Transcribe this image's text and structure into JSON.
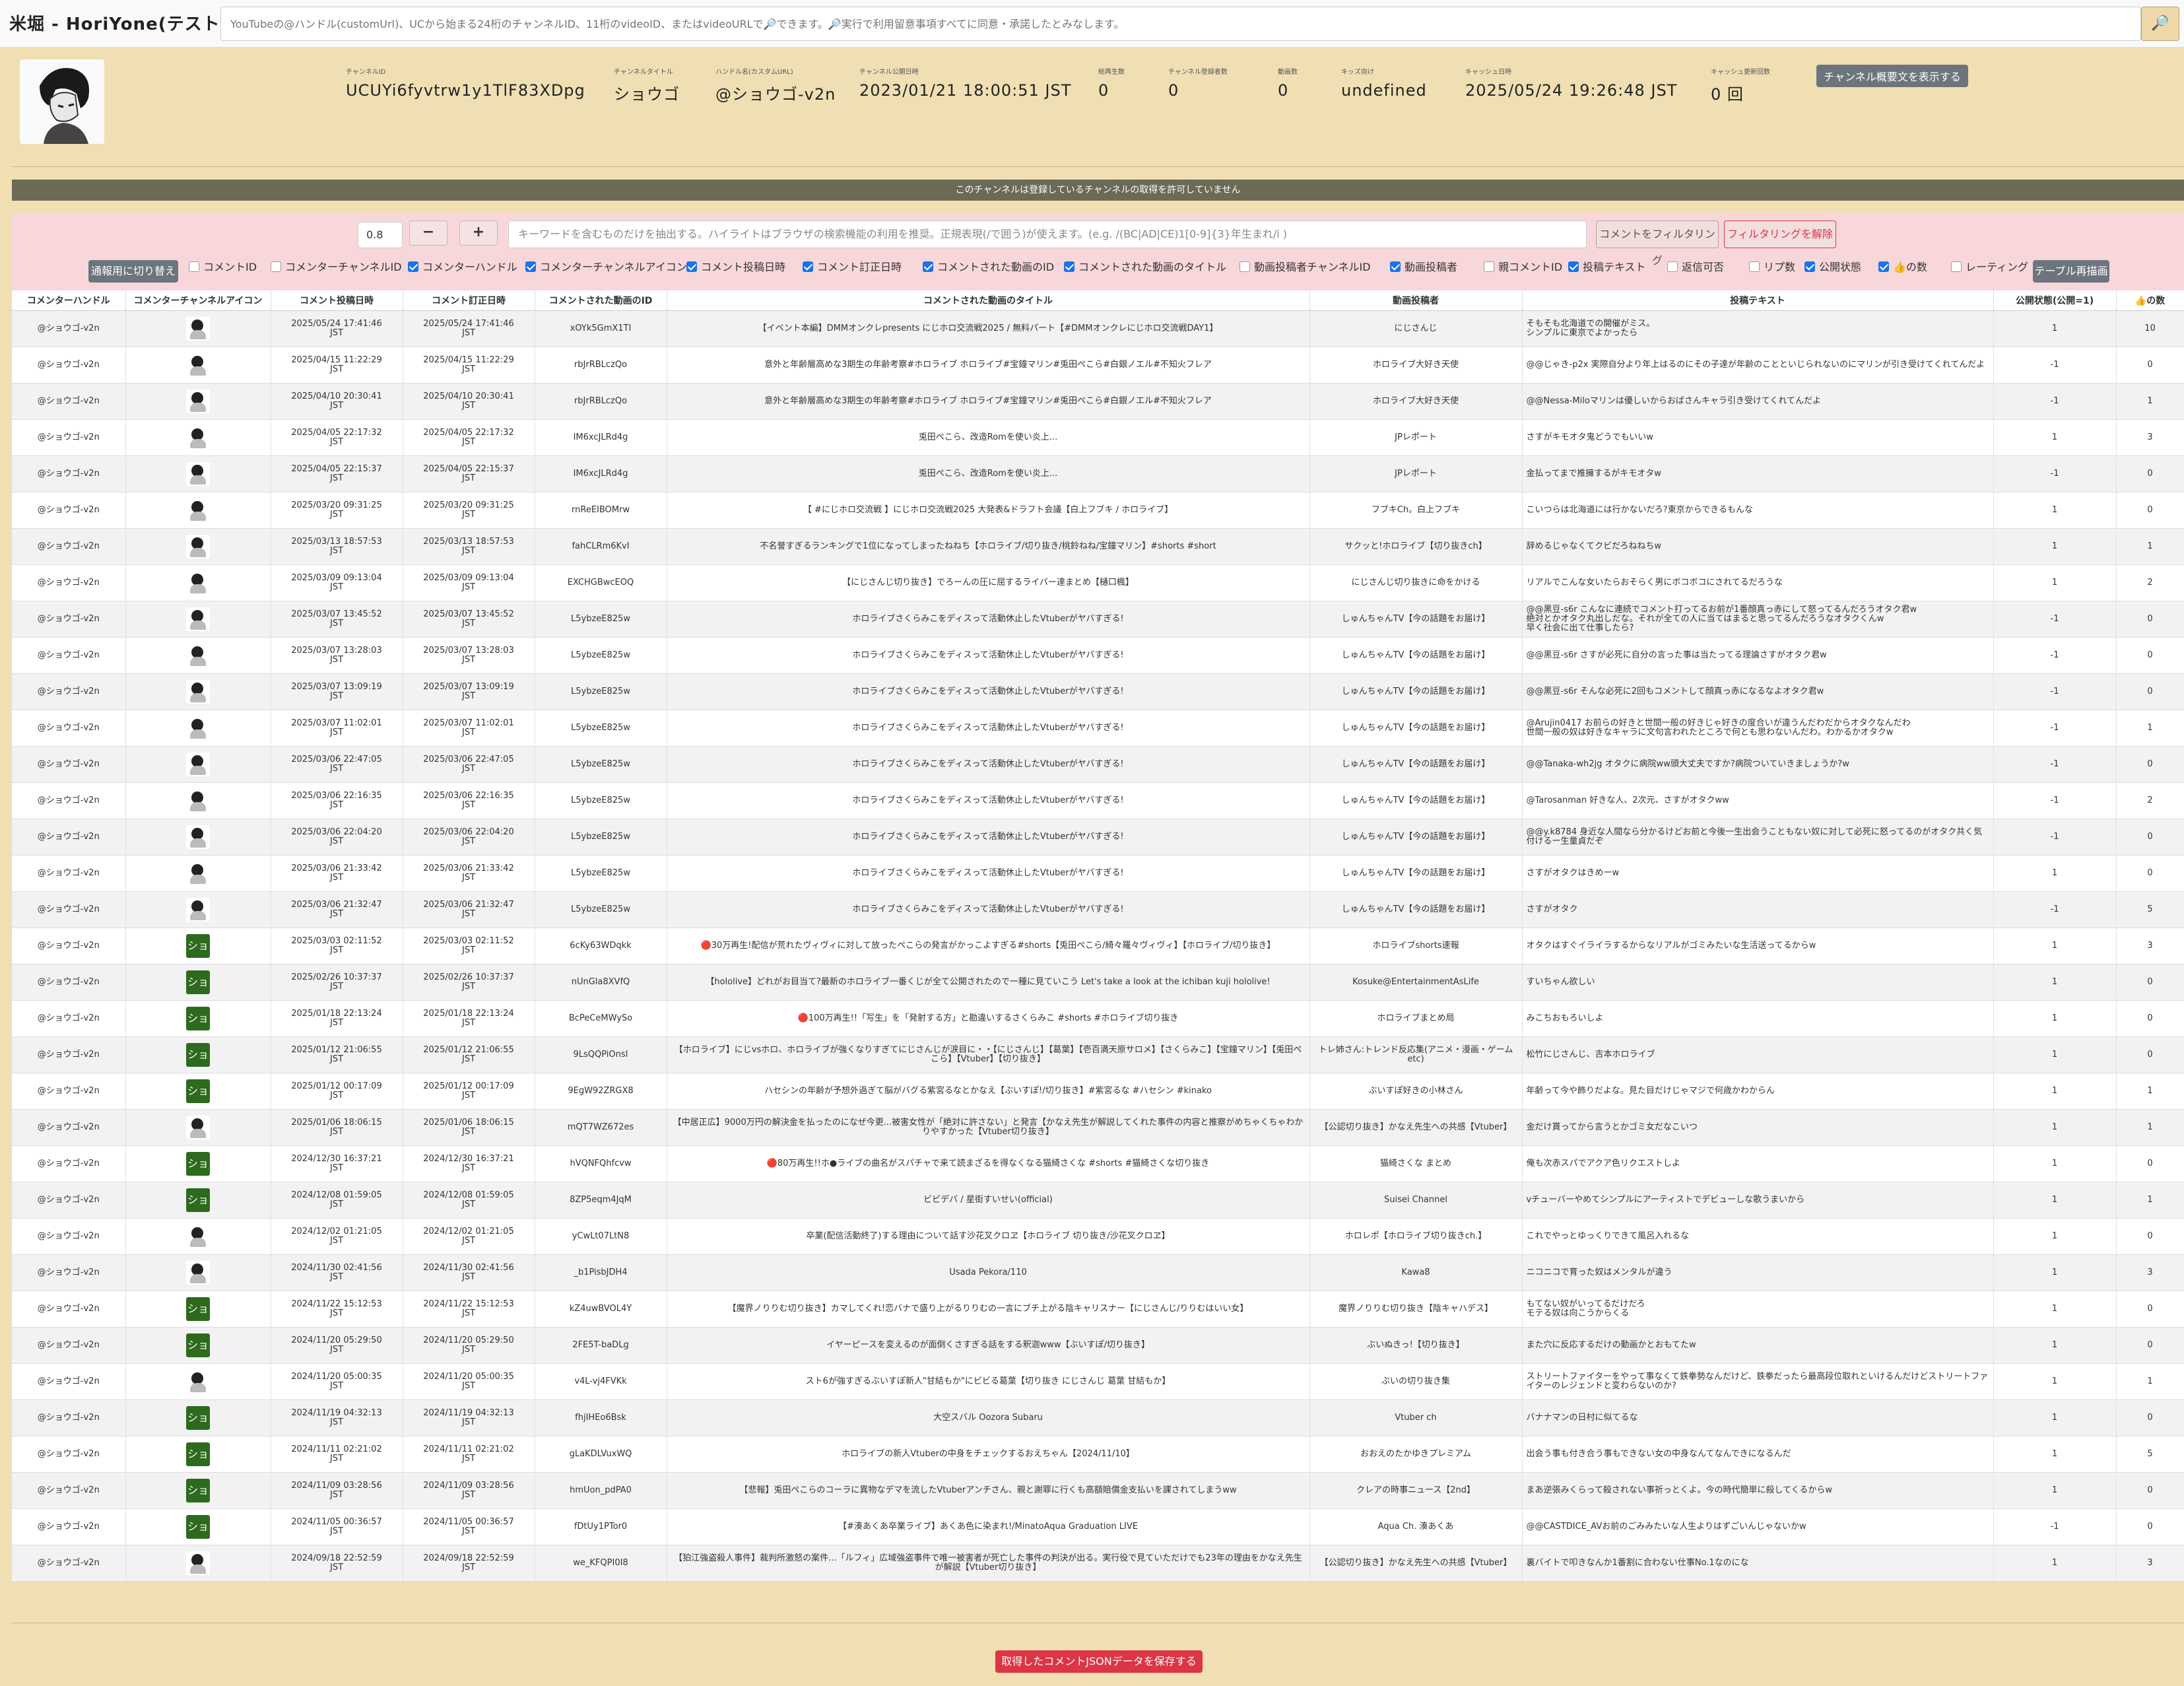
{
  "app": {
    "title": "米堀 - HoriYone(テスト中)",
    "search_placeholder": "YouTubeの@ハンドル(customUrl)、UCから始まる24桁のチャンネルID、11桁のvideoID、またはvideoURLで🔎できます。🔎実行で利用留意事項すべてに同意・承諾したとみなします。",
    "search_icon": "🔎"
  },
  "channel": {
    "fields": [
      {
        "label": "チャンネルID",
        "value": "UCUYi6fyvtrw1y1TlF83XDpg"
      },
      {
        "label": "チャンネルタイトル",
        "value": "ショウゴ"
      },
      {
        "label": "ハンドル名(カスタムURL)",
        "value": "@ショウゴ-v2n"
      },
      {
        "label": "チャンネル公開日時",
        "value": "2023/01/21 18:00:51 JST"
      },
      {
        "label": "総再生数",
        "value": "0"
      },
      {
        "label": "チャンネル登録者数",
        "value": "0"
      },
      {
        "label": "動画数",
        "value": "0"
      },
      {
        "label": "キッズ向け",
        "value": "undefined"
      },
      {
        "label": "キャッシュ日時",
        "value": "2025/05/24 19:26:48 JST"
      },
      {
        "label": "キャッシュ更新回数",
        "value": "0 回"
      }
    ],
    "show_desc_button": "チャンネル概要文を表示する"
  },
  "notice": "このチャンネルは登録しているチャンネルの取得を許可していません",
  "filter": {
    "threshold": "0.8",
    "minus": "−",
    "plus": "+",
    "keyword_placeholder": "キーワードを含むものだけを抽出する。ハイライトはブラウザの検索機能の利用を推奨。正規表現(/で囲う)が使えます。(e.g. /(BC|AD|CE)1[0-9]{3}年生まれ/i )",
    "filter_button": "コメントをフィルタリング",
    "unfilter_button": "フィルタリングを解除"
  },
  "mode_button": "通報用に切り替え",
  "toggles": [
    {
      "label": "コメントID",
      "checked": false
    },
    {
      "label": "コメンターチャンネルID",
      "checked": false
    },
    {
      "label": "コメンターハンドル",
      "checked": true
    },
    {
      "label": "コメンターチャンネルアイコン",
      "checked": true
    },
    {
      "label": "コメント投稿日時",
      "checked": true
    },
    {
      "label": "コメント訂正日時",
      "checked": true
    },
    {
      "label": "コメントされた動画のID",
      "checked": true
    },
    {
      "label": "コメントされた動画のタイトル",
      "checked": true
    },
    {
      "label": "動画投稿者チャンネルID",
      "checked": false
    },
    {
      "label": "動画投稿者",
      "checked": true
    },
    {
      "label": "親コメントID",
      "checked": false
    },
    {
      "label": "投稿テキスト",
      "checked": true
    },
    {
      "label": "返信可否",
      "checked": false
    },
    {
      "label": "リプ数",
      "checked": false
    },
    {
      "label": "公開状態",
      "checked": true
    },
    {
      "label": "👍の数",
      "checked": true
    },
    {
      "label": "レーティング",
      "checked": false
    }
  ],
  "redraw_button": "テーブル再描画",
  "table": {
    "headers": [
      "コメンターハンドル",
      "コメンターチャンネルアイコン",
      "コメント投稿日時",
      "コメント訂正日時",
      "コメントされた動画のID",
      "コメントされた動画のタイトル",
      "動画投稿者",
      "投稿テキスト",
      "公開状態(公開=1)",
      "👍の数"
    ],
    "rows": [
      {
        "handle": "@ショウゴ-v2n",
        "icon": "photo",
        "posted": "2025/05/24 17:41:46",
        "edited": "2025/05/24 17:41:46",
        "tz": "JST",
        "vid": "xOYk5GmX1TI",
        "vtitle": "【イベント本編】DMMオンクレpresents にじホロ交流戦2025 / 無料パート【#DMMオンクレにじホロ交流戦DAY1】",
        "author": "にじさんじ",
        "text": "そもそも北海道での開催がミス。\nシンプルに東京でよかったら",
        "status": "1",
        "likes": "10"
      },
      {
        "handle": "@ショウゴ-v2n",
        "icon": "photo",
        "posted": "2025/04/15 11:22:29",
        "edited": "2025/04/15 11:22:29",
        "tz": "JST",
        "vid": "rbJrRBLczQo",
        "vtitle": "意外と年齢層高めな3期生の年齢考察#ホロライブ ホロライブ#宝鐘マリン#兎田ぺこら#白銀ノエル#不知火フレア",
        "author": "ホロライブ大好き天使",
        "text": "@@じゃき-p2x 実際自分より年上はるのにその子達が年齢のことといじられないのにマリンが引き受けてくれてんだよ",
        "status": "-1",
        "likes": "0"
      },
      {
        "handle": "@ショウゴ-v2n",
        "icon": "photo",
        "posted": "2025/04/10 20:30:41",
        "edited": "2025/04/10 20:30:41",
        "tz": "JST",
        "vid": "rbJrRBLczQo",
        "vtitle": "意外と年齢層高めな3期生の年齢考察#ホロライブ ホロライブ#宝鐘マリン#兎田ぺこら#白銀ノエル#不知火フレア",
        "author": "ホロライブ大好き天使",
        "text": "@@Nessa-Miloマリンは優しいからおばさんキャラ引き受けてくれてんだよ",
        "status": "-1",
        "likes": "1"
      },
      {
        "handle": "@ショウゴ-v2n",
        "icon": "photo",
        "posted": "2025/04/05 22:17:32",
        "edited": "2025/04/05 22:17:32",
        "tz": "JST",
        "vid": "IM6xcJLRd4g",
        "vtitle": "兎田ぺこら、改造Romを使い炎上...",
        "author": "JPレポート",
        "text": "さすがキモオタ鬼どうでもいいw",
        "status": "1",
        "likes": "3"
      },
      {
        "handle": "@ショウゴ-v2n",
        "icon": "photo",
        "posted": "2025/04/05 22:15:37",
        "edited": "2025/04/05 22:15:37",
        "tz": "JST",
        "vid": "IM6xcJLRd4g",
        "vtitle": "兎田ぺこら、改造Romを使い炎上...",
        "author": "JPレポート",
        "text": "金払ってまで推擁するがキモオタw",
        "status": "-1",
        "likes": "0"
      },
      {
        "handle": "@ショウゴ-v2n",
        "icon": "photo",
        "posted": "2025/03/20 09:31:25",
        "edited": "2025/03/20 09:31:25",
        "tz": "JST",
        "vid": "rnReEIBOMrw",
        "vtitle": "【 #にじホロ交流戦 】にじホロ交流戦2025 大発表&ドラフト会議【白上フブキ / ホロライブ】",
        "author": "フブキCh。白上フブキ",
        "text": "こいつらは北海道には行かないだろ?東京からできるもんな",
        "status": "1",
        "likes": "0"
      },
      {
        "handle": "@ショウゴ-v2n",
        "icon": "photo",
        "posted": "2025/03/13 18:57:53",
        "edited": "2025/03/13 18:57:53",
        "tz": "JST",
        "vid": "fahCLRm6KvI",
        "vtitle": "不名誉すぎるランキングで1位になってしまったねねち【ホロライブ/切り抜き/桃鈴ねね/宝鐘マリン】#shorts #short",
        "author": "サクッと!ホロライブ【切り抜きch】",
        "text": "辞めるじゃなくてクビだろねねちw",
        "status": "1",
        "likes": "1"
      },
      {
        "handle": "@ショウゴ-v2n",
        "icon": "photo",
        "posted": "2025/03/09 09:13:04",
        "edited": "2025/03/09 09:13:04",
        "tz": "JST",
        "vid": "EXCHGBwcEOQ",
        "vtitle": "【にじさんじ切り抜き】でろーんの圧に屈するライバー達まとめ【樋口楓】",
        "author": "にじさんじ切り抜きに命をかける",
        "text": "リアルでこんな女いたらおそらく男にボコボコにされてるだろうな",
        "status": "1",
        "likes": "2"
      },
      {
        "handle": "@ショウゴ-v2n",
        "icon": "photo",
        "posted": "2025/03/07 13:45:52",
        "edited": "2025/03/07 13:45:52",
        "tz": "JST",
        "vid": "L5ybzeE825w",
        "vtitle": "ホロライブさくらみこをディスって活動休止したVtuberがヤバすぎる!",
        "author": "しゅんちゃんTV【今の話題をお届け】",
        "text": "@@黒豆-s6r こんなに連続でコメント打ってるお前が1番顔真っ赤にして怒ってるんだろうオタク君w\n絶対とかオタク丸出しだな。それが全ての人に当てはまると思ってるんだろうなオタクくんw\n早く社会に出て仕事したら?",
        "status": "-1",
        "likes": "0"
      },
      {
        "handle": "@ショウゴ-v2n",
        "icon": "photo",
        "posted": "2025/03/07 13:28:03",
        "edited": "2025/03/07 13:28:03",
        "tz": "JST",
        "vid": "L5ybzeE825w",
        "vtitle": "ホロライブさくらみこをディスって活動休止したVtuberがヤバすぎる!",
        "author": "しゅんちゃんTV【今の話題をお届け】",
        "text": "@@黒豆-s6r さすが必死に自分の言った事は当たってる理論さすがオタク君w",
        "status": "-1",
        "likes": "0"
      },
      {
        "handle": "@ショウゴ-v2n",
        "icon": "photo",
        "posted": "2025/03/07 13:09:19",
        "edited": "2025/03/07 13:09:19",
        "tz": "JST",
        "vid": "L5ybzeE825w",
        "vtitle": "ホロライブさくらみこをディスって活動休止したVtuberがヤバすぎる!",
        "author": "しゅんちゃんTV【今の話題をお届け】",
        "text": "@@黒豆-s6r そんな必死に2回もコメントして顔真っ赤になるなよオタク君w",
        "status": "-1",
        "likes": "0"
      },
      {
        "handle": "@ショウゴ-v2n",
        "icon": "photo",
        "posted": "2025/03/07 11:02:01",
        "edited": "2025/03/07 11:02:01",
        "tz": "JST",
        "vid": "L5ybzeE825w",
        "vtitle": "ホロライブさくらみこをディスって活動休止したVtuberがヤバすぎる!",
        "author": "しゅんちゃんTV【今の話題をお届け】",
        "text": "@Arujin0417 お前らの好きと世間一般の好きじゃ好きの度合いが違うんだわだからオタクなんだわ\n世間一般の奴は好きなキャラに文句言われたところで何とも思わないんだわ。わかるかオタクw",
        "status": "-1",
        "likes": "1"
      },
      {
        "handle": "@ショウゴ-v2n",
        "icon": "photo",
        "posted": "2025/03/06 22:47:05",
        "edited": "2025/03/06 22:47:05",
        "tz": "JST",
        "vid": "L5ybzeE825w",
        "vtitle": "ホロライブさくらみこをディスって活動休止したVtuberがヤバすぎる!",
        "author": "しゅんちゃんTV【今の話題をお届け】",
        "text": "@@Tanaka-wh2jg オタクに病院ww頭大丈夫ですか?病院ついていきましょうか?w",
        "status": "-1",
        "likes": "0"
      },
      {
        "handle": "@ショウゴ-v2n",
        "icon": "photo",
        "posted": "2025/03/06 22:16:35",
        "edited": "2025/03/06 22:16:35",
        "tz": "JST",
        "vid": "L5ybzeE825w",
        "vtitle": "ホロライブさくらみこをディスって活動休止したVtuberがヤバすぎる!",
        "author": "しゅんちゃんTV【今の話題をお届け】",
        "text": "@Tarosanman 好きな人、2次元、さすがオタクww",
        "status": "-1",
        "likes": "2"
      },
      {
        "handle": "@ショウゴ-v2n",
        "icon": "photo",
        "posted": "2025/03/06 22:04:20",
        "edited": "2025/03/06 22:04:20",
        "tz": "JST",
        "vid": "L5ybzeE825w",
        "vtitle": "ホロライブさくらみこをディスって活動休止したVtuberがヤバすぎる!",
        "author": "しゅんちゃんTV【今の話題をお届け】",
        "text": "@@y.k8784 身近な人間なら分かるけどお前と今後一生出会うこともない奴に対して必死に怒ってるのがオタク共く気付けるー生童貞だぞ",
        "status": "-1",
        "likes": "0"
      },
      {
        "handle": "@ショウゴ-v2n",
        "icon": "photo",
        "posted": "2025/03/06 21:33:42",
        "edited": "2025/03/06 21:33:42",
        "tz": "JST",
        "vid": "L5ybzeE825w",
        "vtitle": "ホロライブさくらみこをディスって活動休止したVtuberがヤバすぎる!",
        "author": "しゅんちゃんTV【今の話題をお届け】",
        "text": "さすがオタクはきめーw",
        "status": "1",
        "likes": "0"
      },
      {
        "handle": "@ショウゴ-v2n",
        "icon": "photo",
        "posted": "2025/03/06 21:32:47",
        "edited": "2025/03/06 21:32:47",
        "tz": "JST",
        "vid": "L5ybzeE825w",
        "vtitle": "ホロライブさくらみこをディスって活動休止したVtuberがヤバすぎる!",
        "author": "しゅんちゃんTV【今の話題をお届け】",
        "text": "さすがオタク",
        "status": "-1",
        "likes": "5"
      },
      {
        "handle": "@ショウゴ-v2n",
        "icon": "sho",
        "posted": "2025/03/03 02:11:52",
        "edited": "2025/03/03 02:11:52",
        "tz": "JST",
        "vid": "6cKy63WDqkk",
        "vtitle": "🔴30万再生!配信が荒れたヴィヴィに対して放ったぺこらの発言がかっこよすぎる#shorts【兎田ぺこら/綺々羅々ヴィヴィ】【ホロライブ/切り抜き】",
        "author": "ホロライブshorts速報",
        "text": "オタクはすぐイライラするからなリアルがゴミみたいな生活送ってるからw",
        "status": "1",
        "likes": "3"
      },
      {
        "handle": "@ショウゴ-v2n",
        "icon": "sho",
        "posted": "2025/02/26 10:37:37",
        "edited": "2025/02/26 10:37:37",
        "tz": "JST",
        "vid": "nUnGla8XVfQ",
        "vtitle": "【hololive】どれがお目当て?最新のホロライブ一番くじが全て公開されたので一種に見ていこう Let's take a look at the ichiban kuji hololive!",
        "author": "Kosuke@EntertainmentAsLife",
        "text": "すいちゃん欲しい",
        "status": "1",
        "likes": "0"
      },
      {
        "handle": "@ショウゴ-v2n",
        "icon": "sho",
        "posted": "2025/01/18 22:13:24",
        "edited": "2025/01/18 22:13:24",
        "tz": "JST",
        "vid": "BcPeCeMWySo",
        "vtitle": "🔴100万再生!!「写生」を「発射する方」と勘違いするさくらみこ #shorts #ホロライブ切り抜き",
        "author": "ホロライブまとめ局",
        "text": "みこちおもろいしよ",
        "status": "1",
        "likes": "0"
      },
      {
        "handle": "@ショウゴ-v2n",
        "icon": "sho",
        "posted": "2025/01/12 21:06:55",
        "edited": "2025/01/12 21:06:55",
        "tz": "JST",
        "vid": "9LsQQPiOnsI",
        "vtitle": "【ホロライブ】にじvsホロ、ホロライブが強くなりすぎてにじさんじが涙目に・・【にじさんじ】【葛葉】【壱百満天原サロメ】【さくらみこ】【宝鐘マリン】【兎田ぺこら】【Vtuber】【切り抜き】",
        "author": "トレ姉さん:トレンド反応集(アニメ・漫画・ゲーム etc)",
        "text": "松竹にじさんじ、吉本ホロライブ",
        "status": "1",
        "likes": "0"
      },
      {
        "handle": "@ショウゴ-v2n",
        "icon": "sho",
        "posted": "2025/01/12 00:17:09",
        "edited": "2025/01/12 00:17:09",
        "tz": "JST",
        "vid": "9EgW92ZRGX8",
        "vtitle": "ハセシンの年齢が予想外過ぎて脳がバグる紫宮るなとかなえ【ぶいすぽ!/切り抜き】#紫宮るな #ハセシン #kinako",
        "author": "ぶいすぽ好きの小林さん",
        "text": "年齢って今や飾りだよな。見た目だけじゃマジで何歳かわからん",
        "status": "1",
        "likes": "1"
      },
      {
        "handle": "@ショウゴ-v2n",
        "icon": "photo",
        "posted": "2025/01/06 18:06:15",
        "edited": "2025/01/06 18:06:15",
        "tz": "JST",
        "vid": "mQT7WZ672es",
        "vtitle": "【中居正広】9000万円の解決金を払ったのになぜ今更...被害女性が「絶対に許さない」と発言【かなえ先生が解説してくれた事件の内容と推察がめちゃくちゃわかりやすかった【Vtuber切り抜き】",
        "author": "【公認切り抜き】かなえ先生への共感【Vtuber】",
        "text": "金だけ貰ってから言うとかゴミ女だなこいつ",
        "status": "1",
        "likes": "1"
      },
      {
        "handle": "@ショウゴ-v2n",
        "icon": "sho",
        "posted": "2024/12/30 16:37:21",
        "edited": "2024/12/30 16:37:21",
        "tz": "JST",
        "vid": "hVQNFQhfcvw",
        "vtitle": "🔴80万再生!!ホ●ライブの曲名がスパチャで来て読まざるを得なくなる猫綺さくな #shorts #猫綺さくな切り抜き",
        "author": "猫綺さくな まとめ",
        "text": "俺も次赤スパでアクア色リクエストしよ",
        "status": "1",
        "likes": "0"
      },
      {
        "handle": "@ショウゴ-v2n",
        "icon": "sho",
        "posted": "2024/12/08 01:59:05",
        "edited": "2024/12/08 01:59:05",
        "tz": "JST",
        "vid": "8ZP5eqm4JqM",
        "vtitle": "ビビデバ / 星街すいせい(official)",
        "author": "Suisei Channel",
        "text": "vチューバーやめてシンプルにアーティストでデビューしな歌うまいから",
        "status": "1",
        "likes": "1"
      },
      {
        "handle": "@ショウゴ-v2n",
        "icon": "photo",
        "posted": "2024/12/02 01:21:05",
        "edited": "2024/12/02 01:21:05",
        "tz": "JST",
        "vid": "yCwLt07LtN8",
        "vtitle": "卒業(配信活動終了)する理由について話す沙花叉クロヱ【ホロライブ 切り抜き/沙花叉クロヱ】",
        "author": "ホロレポ【ホロライブ切り抜きch.】",
        "text": "これでやっとゆっくりできて風呂入れるな",
        "status": "1",
        "likes": "0"
      },
      {
        "handle": "@ショウゴ-v2n",
        "icon": "photo",
        "posted": "2024/11/30 02:41:56",
        "edited": "2024/11/30 02:41:56",
        "tz": "JST",
        "vid": "_b1PisbJDH4",
        "vtitle": "Usada Pekora/110",
        "author": "Kawa8",
        "text": "ニコニコで育った奴はメンタルが違う",
        "status": "1",
        "likes": "3"
      },
      {
        "handle": "@ショウゴ-v2n",
        "icon": "sho",
        "posted": "2024/11/22 15:12:53",
        "edited": "2024/11/22 15:12:53",
        "tz": "JST",
        "vid": "kZ4uwBVOL4Y",
        "vtitle": "【魔界ノりりむ切り抜き】カマしてくれ!恋バナで盛り上がるりりむの一言にブチ上がる陰キャリスナー【にじさんじ/りりむはいい女】",
        "author": "魔界ノりりむ切り抜き【陰キャハデス】",
        "text": "もてない奴がいってるだけだろ\nモテる奴は向こうからくる",
        "status": "1",
        "likes": "0"
      },
      {
        "handle": "@ショウゴ-v2n",
        "icon": "sho",
        "posted": "2024/11/20 05:29:50",
        "edited": "2024/11/20 05:29:50",
        "tz": "JST",
        "vid": "2FE5T-baDLg",
        "vtitle": "イヤーピースを変えるのが面倒くさすぎる話をする釈迦www【ぶいすぽ/切り抜き】",
        "author": "ぶいぬきっ!【切り抜き】",
        "text": "また穴に反応するだけの動画かとおもてたw",
        "status": "1",
        "likes": "0"
      },
      {
        "handle": "@ショウゴ-v2n",
        "icon": "photo",
        "posted": "2024/11/20 05:00:35",
        "edited": "2024/11/20 05:00:35",
        "tz": "JST",
        "vid": "v4L-vj4FVKk",
        "vtitle": "スト6が強すぎるぶいすぽ新人\"甘結もか\"にビビる葛葉【切り抜き にじさんじ 葛葉 甘結もか】",
        "author": "ぶいの切り抜き集",
        "text": "ストリートファイターをやって事なくて鉄拳勢なんだけど、鉄拳だったら最高段位取れといけるんだけどストリートファイターのレジェンドと変わらないのか?",
        "status": "1",
        "likes": "1"
      },
      {
        "handle": "@ショウゴ-v2n",
        "icon": "sho",
        "posted": "2024/11/19 04:32:13",
        "edited": "2024/11/19 04:32:13",
        "tz": "JST",
        "vid": "fhjIHEo6Bsk",
        "vtitle": "大空スバル Oozora Subaru",
        "author": "Vtuber ch",
        "text": "バナナマンの日村に似てるな",
        "status": "1",
        "likes": "0"
      },
      {
        "handle": "@ショウゴ-v2n",
        "icon": "sho",
        "posted": "2024/11/11 02:21:02",
        "edited": "2024/11/11 02:21:02",
        "tz": "JST",
        "vid": "gLaKDLVuxWQ",
        "vtitle": "ホロライブの新人Vtuberの中身をチェックするおえちゃん【2024/11/10】",
        "author": "おおえのたかゆきプレミアム",
        "text": "出会う事も付き合う事もできない女の中身なんてなんできになるんだ",
        "status": "1",
        "likes": "5"
      },
      {
        "handle": "@ショウゴ-v2n",
        "icon": "sho",
        "posted": "2024/11/09 03:28:56",
        "edited": "2024/11/09 03:28:56",
        "tz": "JST",
        "vid": "hmUon_pdPA0",
        "vtitle": "【悲報】兎田ぺこらのコーラに異物なデマを流したVtuberアンチさん、親と謝罪に行くも高額賠償金支払いを課されてしまうww",
        "author": "クレアの時事ニュース【2nd】",
        "text": "まあ逆張みくらって殺されない事祈っとくよ。今の時代簡単に殺してくるからw",
        "status": "1",
        "likes": "0"
      },
      {
        "handle": "@ショウゴ-v2n",
        "icon": "sho",
        "posted": "2024/11/05 00:36:57",
        "edited": "2024/11/05 00:36:57",
        "tz": "JST",
        "vid": "fDtUy1PTor0",
        "vtitle": "【#湊あくあ卒業ライブ】あくあ色に染まれ!/MinatoAqua Graduation LIVE",
        "author": "Aqua Ch. 湊あくあ",
        "text": "@@CASTDICE_AVお前のごみみたいな人生よりはずごいんじゃないかw",
        "status": "-1",
        "likes": "0"
      },
      {
        "handle": "@ショウゴ-v2n",
        "icon": "photo",
        "posted": "2024/09/18 22:52:59",
        "edited": "2024/09/18 22:52:59",
        "tz": "JST",
        "vid": "we_KFQPI0I8",
        "vtitle": "【狛江強盗殺人事件】裁判所激怒の案件...「ルフィ」広域強盗事件で唯一被害者が死亡した事件の判決が出る。実行役で見ていただけでも23年の理由をかなえ先生が解説【Vtuber切り抜き】",
        "author": "【公認切り抜き】かなえ先生への共感【Vtuber】",
        "text": "裏バイトで叩きなんか1番割に合わない仕事No.1なのにな",
        "status": "1",
        "likes": "3"
      }
    ]
  },
  "save_button": "取得したコメントJSONデータを保存する"
}
